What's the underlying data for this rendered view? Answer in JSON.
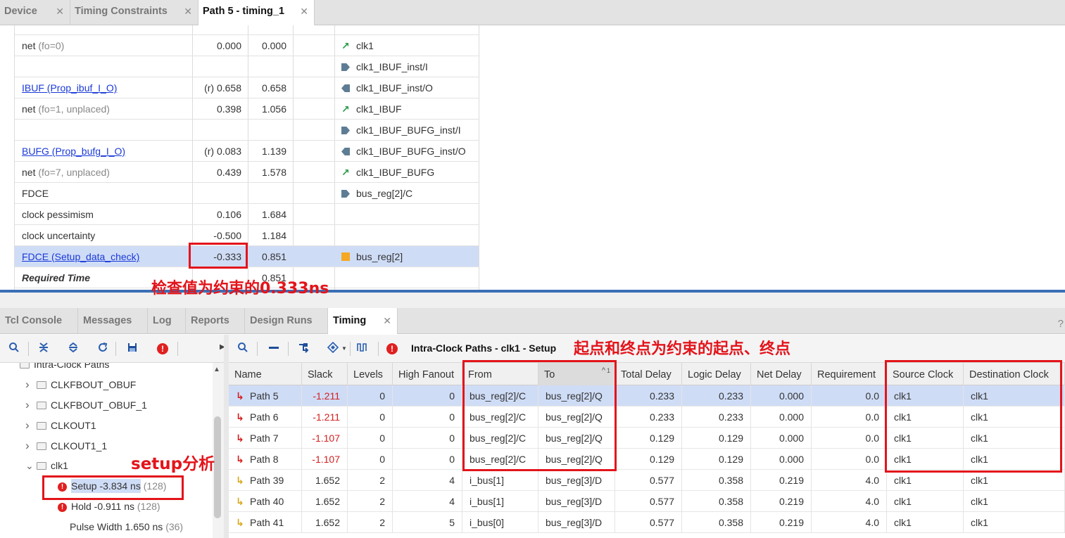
{
  "top_tabs": [
    {
      "label": "Device"
    },
    {
      "label": "Timing Constraints"
    },
    {
      "label": "Path 5 - timing_1"
    }
  ],
  "upper_rows": [
    {
      "desc": "net",
      "desc_extra": "(fo=0)",
      "incr": "0.000",
      "path": "0.000",
      "icon": "net-arrow-icon",
      "location": "clk1"
    },
    {
      "desc": "",
      "desc_extra": "",
      "incr": "",
      "path": "",
      "icon": "input-pin-icon",
      "location": "clk1_IBUF_inst/I"
    },
    {
      "desc": "IBUF (Prop_ibuf_I_O)",
      "link": true,
      "incr": "(r) 0.658",
      "path": "0.658",
      "icon": "output-pin-icon",
      "location": "clk1_IBUF_inst/O"
    },
    {
      "desc": "net",
      "desc_extra": "(fo=1, unplaced)",
      "incr": "0.398",
      "path": "1.056",
      "icon": "net-arrow-icon",
      "location": "clk1_IBUF"
    },
    {
      "desc": "",
      "desc_extra": "",
      "incr": "",
      "path": "",
      "icon": "input-pin-icon",
      "location": "clk1_IBUF_BUFG_inst/I"
    },
    {
      "desc": "BUFG (Prop_bufg_I_O)",
      "link": true,
      "incr": "(r) 0.083",
      "path": "1.139",
      "icon": "output-pin-icon",
      "location": "clk1_IBUF_BUFG_inst/O"
    },
    {
      "desc": "net",
      "desc_extra": "(fo=7, unplaced)",
      "incr": "0.439",
      "path": "1.578",
      "icon": "net-arrow-icon",
      "location": "clk1_IBUF_BUFG"
    },
    {
      "desc": "FDCE",
      "desc_extra": "",
      "incr": "",
      "path": "",
      "icon": "input-pin-icon",
      "location": "bus_reg[2]/C"
    },
    {
      "desc": "clock pessimism",
      "desc_extra": "",
      "incr": "0.106",
      "path": "1.684",
      "icon": "",
      "location": ""
    },
    {
      "desc": "clock uncertainty",
      "desc_extra": "",
      "incr": "-0.500",
      "path": "1.184",
      "icon": "",
      "location": ""
    },
    {
      "desc": "FDCE (Setup_data_check)",
      "link": true,
      "selected": true,
      "incr": "-0.333",
      "path": "0.851",
      "icon": "cell-icon",
      "location": "bus_reg[2]"
    },
    {
      "desc": "Required Time",
      "bold_italic": true,
      "incr": "",
      "path": "0.851",
      "icon": "",
      "location": ""
    }
  ],
  "bottom_tabs": [
    {
      "label": "Tcl Console"
    },
    {
      "label": "Messages"
    },
    {
      "label": "Log"
    },
    {
      "label": "Reports"
    },
    {
      "label": "Design Runs"
    },
    {
      "label": "Timing"
    }
  ],
  "toolbar_title": "Intra-Clock Paths - clk1 - Setup",
  "tree": [
    {
      "label": "Intra-Clock Paths",
      "indent": 0
    },
    {
      "label": "CLKFBOUT_OBUF",
      "indent": 1
    },
    {
      "label": "CLKFBOUT_OBUF_1",
      "indent": 1
    },
    {
      "label": "CLKOUT1",
      "indent": 1
    },
    {
      "label": "CLKOUT1_1",
      "indent": 1
    },
    {
      "label": "clk1",
      "indent": 1
    },
    {
      "label": "Setup -3.834 ns",
      "count": "(128)"
    },
    {
      "label": "Hold -0.911 ns",
      "count": "(128)"
    },
    {
      "label": "Pulse Width 1.650 ns",
      "count": "(36)"
    }
  ],
  "columns": [
    "Name",
    "Slack",
    "Levels",
    "High Fanout",
    "From",
    "To",
    "Total Delay",
    "Logic Delay",
    "Net Delay",
    "Requirement",
    "Source Clock",
    "Destination Clock"
  ],
  "sort_indicator": "1",
  "paths": [
    {
      "name": "Path 5",
      "slack": "-1.211",
      "levels": "0",
      "fanout": "0",
      "from": "bus_reg[2]/C",
      "to": "bus_reg[2]/Q",
      "total": "0.233",
      "logic": "0.233",
      "net": "0.000",
      "req": "0.0",
      "src": "clk1",
      "dst": "clk1"
    },
    {
      "name": "Path 6",
      "slack": "-1.211",
      "levels": "0",
      "fanout": "0",
      "from": "bus_reg[2]/C",
      "to": "bus_reg[2]/Q",
      "total": "0.233",
      "logic": "0.233",
      "net": "0.000",
      "req": "0.0",
      "src": "clk1",
      "dst": "clk1"
    },
    {
      "name": "Path 7",
      "slack": "-1.107",
      "levels": "0",
      "fanout": "0",
      "from": "bus_reg[2]/C",
      "to": "bus_reg[2]/Q",
      "total": "0.129",
      "logic": "0.129",
      "net": "0.000",
      "req": "0.0",
      "src": "clk1",
      "dst": "clk1"
    },
    {
      "name": "Path 8",
      "slack": "-1.107",
      "levels": "0",
      "fanout": "0",
      "from": "bus_reg[2]/C",
      "to": "bus_reg[2]/Q",
      "total": "0.129",
      "logic": "0.129",
      "net": "0.000",
      "req": "0.0",
      "src": "clk1",
      "dst": "clk1"
    },
    {
      "name": "Path 39",
      "slack": "1.652",
      "levels": "2",
      "fanout": "4",
      "from": "i_bus[1]",
      "to": "bus_reg[3]/D",
      "total": "0.577",
      "logic": "0.358",
      "net": "0.219",
      "req": "4.0",
      "src": "clk1",
      "dst": "clk1"
    },
    {
      "name": "Path 40",
      "slack": "1.652",
      "levels": "2",
      "fanout": "4",
      "from": "i_bus[1]",
      "to": "bus_reg[3]/D",
      "total": "0.577",
      "logic": "0.358",
      "net": "0.219",
      "req": "4.0",
      "src": "clk1",
      "dst": "clk1"
    },
    {
      "name": "Path 41",
      "slack": "1.652",
      "levels": "2",
      "fanout": "5",
      "from": "i_bus[0]",
      "to": "bus_reg[3]/D",
      "total": "0.577",
      "logic": "0.358",
      "net": "0.219",
      "req": "4.0",
      "src": "clk1",
      "dst": "clk1"
    }
  ],
  "annotations": {
    "check_value": "检查值为约束的0.333ns",
    "start_end": "起点和终点为约束的起点、终点",
    "setup": "setup分析"
  },
  "colors": {
    "accent": "#3b6fb6",
    "annotation": "#e3141b",
    "selected_row": "#cfdcf6",
    "negative_slack": "#d42020"
  }
}
